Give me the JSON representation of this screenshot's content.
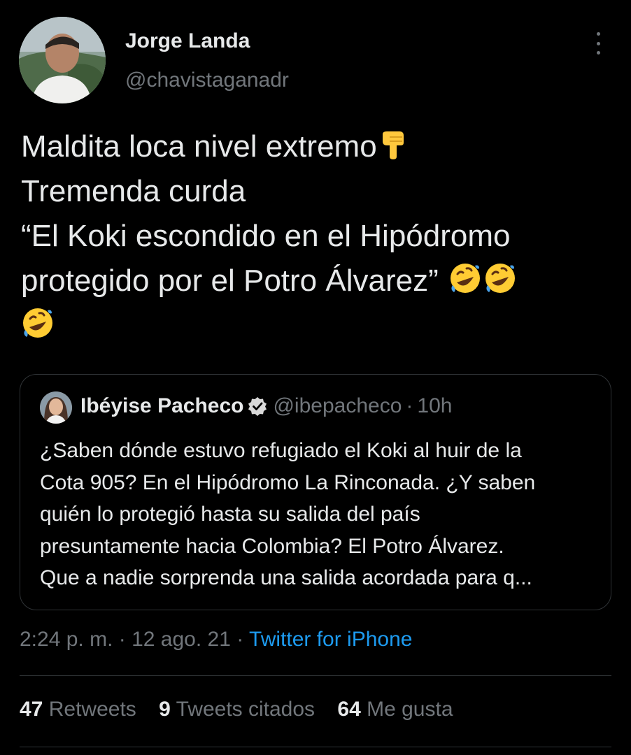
{
  "author": {
    "name": "Jorge Landa",
    "handle": "@chavistaganadr"
  },
  "tweet": {
    "lines": [
      "Maldita loca nivel extremo",
      "Tremenda curda",
      "“El Koki escondido en el Hipódromo",
      "protegido por el Potro Álvarez”"
    ],
    "emojis": [
      "backhand-index-pointing-down",
      "rolling-on-the-floor-laughing",
      "rolling-on-the-floor-laughing",
      "rolling-on-the-floor-laughing"
    ]
  },
  "quoted_tweet": {
    "name": "Ibéyise Pacheco",
    "verified": true,
    "handle": "@ibepacheco",
    "separator": "·",
    "time": "10h",
    "lines": [
      "¿Saben dónde estuvo refugiado el Koki al huir de la",
      "Cota 905? En el Hipódromo La Rinconada. ¿Y saben",
      "quién lo protegió hasta su salida del país",
      "presuntamente hacia Colombia? El Potro Álvarez.",
      "Que a nadie sorprenda una salida acordada para q..."
    ]
  },
  "meta": {
    "time": "2:24 p. m.",
    "sep1": "·",
    "date": "12 ago. 21",
    "sep2": "·",
    "source": "Twitter for iPhone"
  },
  "stats": {
    "retweets_count": "47",
    "retweets_label": "Retweets",
    "quotes_count": "9",
    "quotes_label": "Tweets citados",
    "likes_count": "64",
    "likes_label": "Me gusta"
  },
  "colors": {
    "background": "#000000",
    "text": "#e7e9ea",
    "secondary": "#71767b",
    "link": "#1d9bf0",
    "border": "#2f3336"
  }
}
